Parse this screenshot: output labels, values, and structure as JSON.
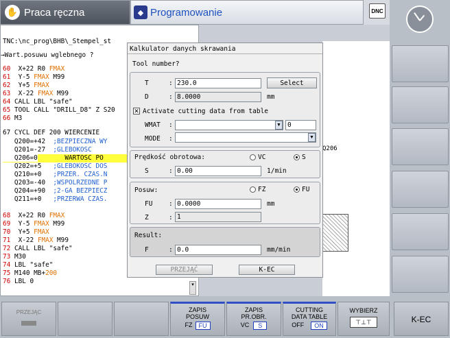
{
  "modes": {
    "manual": "Praca ręczna",
    "programming": "Programowanie",
    "dnc": "DNC"
  },
  "program": {
    "path": "TNC:\\nc_prog\\BHB\\_Stempel_st",
    "header": "→Wart.posuwu wglebnego ?",
    "lines": [
      {
        "n": "60",
        "t": "  X+22 R0 ",
        "k": "FMAX",
        "r": ""
      },
      {
        "n": "61",
        "t": "  Y-5 ",
        "k": "FMAX",
        "r": " M99"
      },
      {
        "n": "62",
        "t": "  Y+5 ",
        "k": "FMAX",
        "r": ""
      },
      {
        "n": "63",
        "t": "  X-22 ",
        "k": "FMAX",
        "r": " M99"
      },
      {
        "n": "64",
        "t": " CALL LBL \"safe\"",
        "k": "",
        "r": ""
      },
      {
        "n": "65",
        "t": " TOOL CALL \"DRILL_D8\" Z S20",
        "k": "",
        "r": ""
      },
      {
        "n": "66",
        "t": " M3",
        "k": "",
        "r": ""
      }
    ],
    "cycle_line": "67 CYCL DEF 200 WIERCENIE",
    "params": [
      {
        "p": "   Q200=+42",
        "c": "  ;BEZPIECZNA WY"
      },
      {
        "p": "   Q201=-27",
        "c": "  ;GLEBOKOSC"
      },
      {
        "p": "   Q206=0",
        "c": "       WARTOSC PO"
      },
      {
        "p": "   Q202=+5",
        "c": "   ;GLEBOKOSC DOS"
      },
      {
        "p": "   Q210=+0",
        "c": "   ;PRZER. CZAS.N"
      },
      {
        "p": "   Q203=-40",
        "c": "  ;WSPOLRZEDNE P"
      },
      {
        "p": "   Q204=+90",
        "c": "  ;2-GA BEZPIECZ"
      },
      {
        "p": "   Q211=+0",
        "c": "   ;PRZERWA CZAS."
      }
    ],
    "lines2": [
      {
        "n": "68",
        "t": "  X+22 R0 ",
        "k": "FMAX",
        "r": ""
      },
      {
        "n": "69",
        "t": "  Y-5 ",
        "k": "FMAX",
        "r": " M99"
      },
      {
        "n": "70",
        "t": "  Y+5 ",
        "k": "FMAX",
        "r": ""
      },
      {
        "n": "71",
        "t": "  X-22 ",
        "k": "FMAX",
        "r": " M99"
      },
      {
        "n": "72",
        "t": " CALL LBL \"safe\"",
        "k": "",
        "r": ""
      },
      {
        "n": "73",
        "t": " M30",
        "k": "",
        "r": ""
      },
      {
        "n": "74",
        "t": " LBL \"safe\"",
        "k": "",
        "r": ""
      },
      {
        "n": "75",
        "t": " M140 MB+",
        "k": "",
        "r": "200"
      },
      {
        "n": "76",
        "t": " LBL 0",
        "k": "",
        "r": ""
      }
    ]
  },
  "q206_label": "Q206",
  "dialog": {
    "title": "Kalkulator danych skrawania",
    "tool_number": "Tool number?",
    "t_label": "T",
    "t_value": "230.0",
    "select": "Select",
    "d_label": "D",
    "d_value": "8.0000",
    "d_unit": "mm",
    "activate": "Activate cutting data from table",
    "wmat_label": "WMAT",
    "wmat_num": "0",
    "mode_label": "MODE",
    "speed_title": "Prędkość obrotowa:",
    "vc": "VC",
    "s_radio": "S",
    "s_label": "S",
    "s_value": "0.00",
    "s_unit": "1/min",
    "feed_title": "Posuw:",
    "fz": "FZ",
    "fu": "FU",
    "fu_label": "FU",
    "fu_value": "0.0000",
    "fu_unit": "mm",
    "z_label": "Z",
    "z_value": "1",
    "result_title": "Result:",
    "f_label": "F",
    "f_value": "0.0",
    "f_unit": "mm/min",
    "apply": "PRZEJĄĆ",
    "kec": "K-EC"
  },
  "softkeys": {
    "przejac": "PRZEJĄC",
    "zapis_posuw": [
      "ZAPIS",
      "POSUW"
    ],
    "fz": "FZ",
    "fu": "FU",
    "zapis_pr": [
      "ZAPIS",
      "PR.OBR."
    ],
    "vc": "VC",
    "s": "S",
    "cutting": [
      "CUTTING",
      "DATA TABLE"
    ],
    "off": "OFF",
    "on": "ON",
    "wybierz": "WYBIERZ",
    "kec": "K-EC"
  }
}
